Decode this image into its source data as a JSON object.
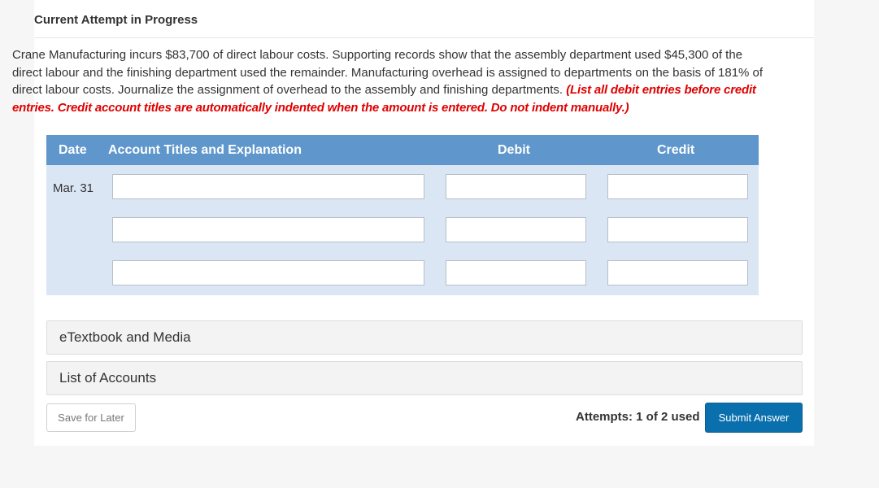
{
  "header": {
    "title": "Current Attempt in Progress"
  },
  "question": {
    "text": "Crane Manufacturing incurs $83,700 of direct labour costs. Supporting records show that the assembly department used $45,300 of the direct labour and the finishing department used the remainder. Manufacturing overhead is assigned to departments on the basis of 181% of direct labour costs. Journalize the assignment of overhead to the assembly and finishing departments.",
    "instruction": "(List all debit entries before credit entries. Credit account titles are automatically indented when the amount is entered. Do not indent manually.)"
  },
  "journal": {
    "headers": {
      "date": "Date",
      "account": "Account Titles and Explanation",
      "debit": "Debit",
      "credit": "Credit"
    },
    "date": "Mar. 31",
    "rows": [
      {
        "account": "",
        "debit": "",
        "credit": ""
      },
      {
        "account": "",
        "debit": "",
        "credit": ""
      },
      {
        "account": "",
        "debit": "",
        "credit": ""
      }
    ]
  },
  "resources": {
    "etextbook": "eTextbook and Media",
    "accounts": "List of Accounts"
  },
  "footer": {
    "save_label": "Save for Later",
    "attempts": "Attempts: 1 of 2 used",
    "submit_label": "Submit Answer"
  }
}
